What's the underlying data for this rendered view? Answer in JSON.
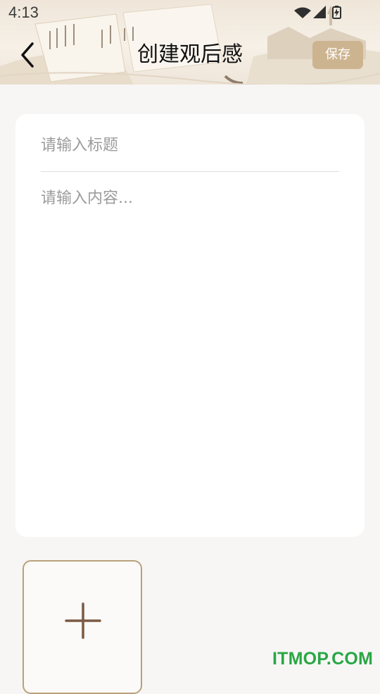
{
  "status_bar": {
    "time": "4:13",
    "icons": [
      "wifi-icon",
      "signal-icon",
      "battery-charging-icon"
    ]
  },
  "header": {
    "back_icon": "chevron-left-icon",
    "title": "创建观后感",
    "save_label": "保存"
  },
  "editor": {
    "title_placeholder": "请输入标题",
    "title_value": "",
    "content_placeholder": "请输入内容...",
    "content_value": ""
  },
  "attachments": {
    "add_icon": "plus-icon"
  },
  "watermark": {
    "text": "ITMOP.COM"
  },
  "colors": {
    "accent": "#cdb490",
    "border_accent": "#b9a07c",
    "plus": "#7b5a43",
    "watermark": "#29a744",
    "page_bg": "#f7f6f5",
    "card_bg": "#ffffff"
  }
}
